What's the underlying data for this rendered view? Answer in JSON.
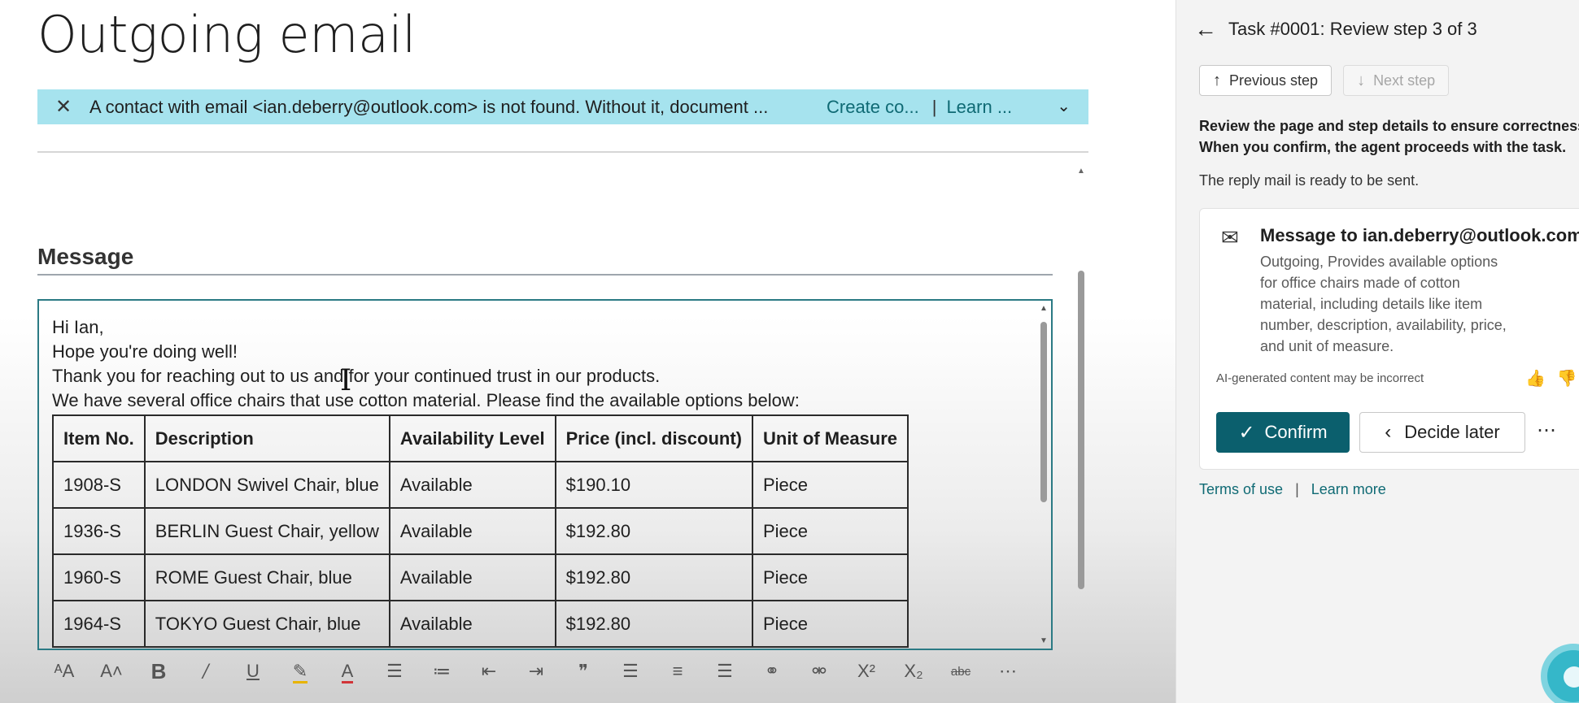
{
  "page": {
    "title": "Outgoing email"
  },
  "banner": {
    "message": "A contact with email <ian.deberry@outlook.com> is not found. Without it, document ...",
    "create_link": "Create co...",
    "separator": "|",
    "learn_link": "Learn ..."
  },
  "message_section": {
    "title": "Message"
  },
  "email": {
    "lines": [
      "Hi Ian,",
      "Hope you're doing well!",
      "Thank you for reaching out to us and for your continued trust in our products.",
      "We have several office chairs that use cotton material. Please find the available options below:"
    ],
    "table": {
      "headers": [
        "Item No.",
        "Description",
        "Availability Level",
        "Price (incl. discount)",
        "Unit of Measure"
      ],
      "rows": [
        [
          "1908-S",
          "LONDON Swivel Chair, blue",
          "Available",
          "$190.10",
          "Piece"
        ],
        [
          "1936-S",
          "BERLIN Guest Chair, yellow",
          "Available",
          "$192.80",
          "Piece"
        ],
        [
          "1960-S",
          "ROME Guest Chair, blue",
          "Available",
          "$192.80",
          "Piece"
        ],
        [
          "1964-S",
          "TOKYO Guest Chair, blue",
          "Available",
          "$192.80",
          "Piece"
        ]
      ]
    }
  },
  "toolbar": {
    "icons": [
      "font-size-icon",
      "grow-font-icon",
      "bold-icon",
      "italic-icon",
      "underline-icon",
      "highlight-icon",
      "font-color-icon",
      "bullet-list-icon",
      "numbered-list-icon",
      "decrease-indent-icon",
      "increase-indent-icon",
      "quote-icon",
      "align-left-icon",
      "align-center-icon",
      "align-right-icon",
      "link-icon",
      "unlink-icon",
      "superscript-icon",
      "subscript-icon",
      "strikethrough-icon",
      "more-icon"
    ]
  },
  "panel": {
    "header": "Task #0001: Review step 3 of 3",
    "prev_step": "Previous step",
    "next_step": "Next step",
    "instructions_line1": "Review the page and step details to ensure correctness.",
    "instructions_line2": "When you confirm, the agent proceeds with the task.",
    "ready_text": "The reply mail is ready to be sent.",
    "card": {
      "title": "Message to ian.deberry@outlook.com",
      "description": "Outgoing, Provides available options for office chairs made of cotton material, including details like item number, description, availability, price, and unit of measure.",
      "ai_note": "AI-generated content may be incorrect",
      "confirm_label": "Confirm",
      "decide_later_label": "Decide later"
    },
    "terms_link": "Terms of use",
    "footer_separator": "|",
    "learn_more_link": "Learn more"
  },
  "colors": {
    "banner_bg": "#a6e3ee",
    "link": "#0f6a74",
    "confirm_bg": "#0b5f6d",
    "editor_border": "#2b7a84"
  }
}
